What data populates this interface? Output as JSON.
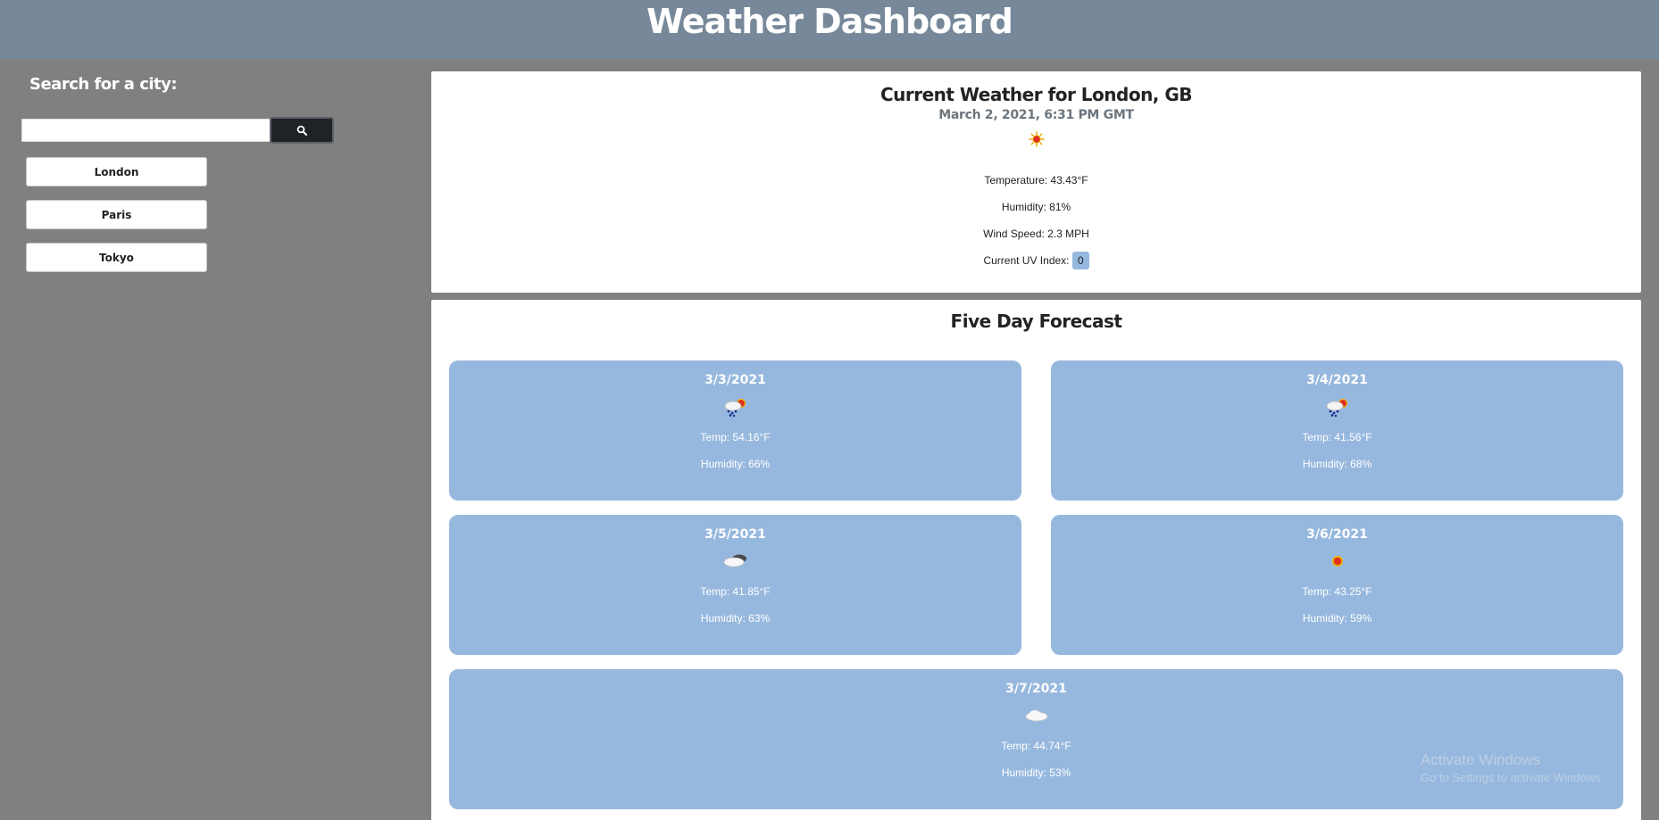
{
  "header": {
    "title": "Weather Dashboard"
  },
  "sidebar": {
    "heading": "Search for a city:",
    "search": {
      "value": "",
      "placeholder": ""
    },
    "cities": [
      "London",
      "Paris",
      "Tokyo"
    ]
  },
  "current": {
    "title": "Current Weather for London, GB",
    "datetime": "March 2, 2021, 6:31 PM GMT",
    "icon": "sun-icon",
    "temperature": "Temperature: 43.43°F",
    "humidity": "Humidity: 81%",
    "wind": "Wind Speed: 2.3 MPH",
    "uv_label": "Current UV Index:",
    "uv_value": "0"
  },
  "forecast": {
    "title": "Five Day Forecast",
    "days": [
      {
        "date": "3/3/2021",
        "icon": "rain-sun-icon",
        "temp": "Temp: 54.16°F",
        "humidity": "Humidity: 66%"
      },
      {
        "date": "3/4/2021",
        "icon": "rain-sun-icon",
        "temp": "Temp: 41.56°F",
        "humidity": "Humidity: 68%"
      },
      {
        "date": "3/5/2021",
        "icon": "broken-clouds-icon",
        "temp": "Temp: 41.85°F",
        "humidity": "Humidity: 63%"
      },
      {
        "date": "3/6/2021",
        "icon": "sun-icon",
        "temp": "Temp: 43.25°F",
        "humidity": "Humidity: 59%"
      },
      {
        "date": "3/7/2021",
        "icon": "cloud-icon",
        "temp": "Temp: 44.74°F",
        "humidity": "Humidity: 53%"
      }
    ]
  },
  "watermark": {
    "title": "Activate Windows",
    "subtitle": "Go to Settings to activate Windows."
  },
  "colors": {
    "header": "#77889a",
    "background": "#808080",
    "card": "#97b8de",
    "search_button": "#1f2227"
  }
}
